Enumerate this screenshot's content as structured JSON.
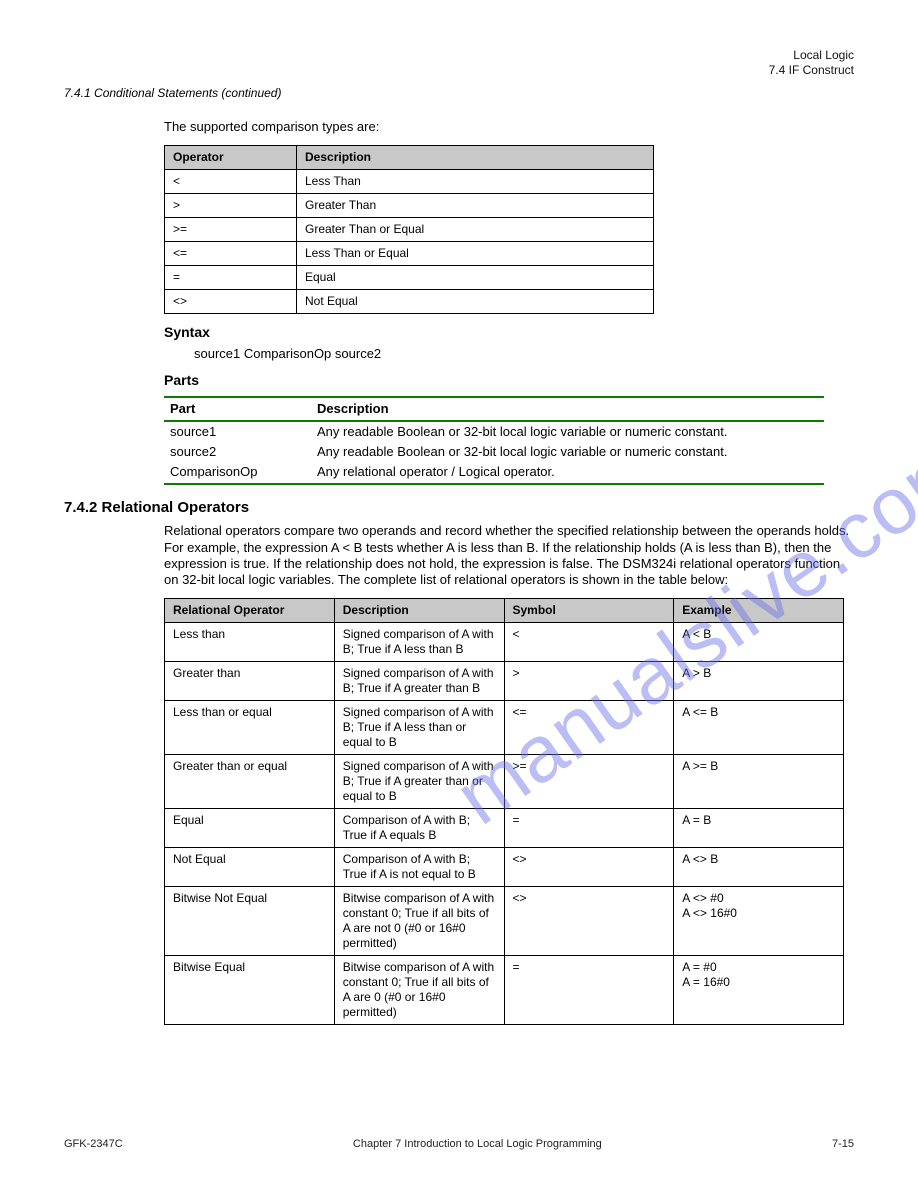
{
  "header": {
    "right_line1": "Local Logic",
    "right_line2": "7.4 IF Construct",
    "left": "7.4.1 Conditional Statements (continued)"
  },
  "comparison_section": {
    "intro": "The supported comparison types are:",
    "headers": [
      "Operator",
      "Description"
    ],
    "rows": [
      [
        "<",
        "Less Than"
      ],
      [
        ">",
        "Greater Than"
      ],
      [
        ">=",
        "Greater Than or Equal"
      ],
      [
        "<=",
        "Less Than or Equal"
      ],
      [
        "=",
        "Equal"
      ],
      [
        "<>",
        "Not Equal"
      ]
    ]
  },
  "syntax_section": {
    "title": "Syntax",
    "line": "source1 ComparisonOp source2"
  },
  "parts_section": {
    "title": "Parts",
    "headers": [
      "Part",
      "Description"
    ],
    "rows": [
      [
        "source1",
        "Any readable Boolean or 32-bit local logic variable or numeric constant."
      ],
      [
        "source2",
        "Any readable Boolean or 32-bit local logic variable or numeric constant."
      ],
      [
        "ComparisonOp",
        "Any relational operator / Logical operator."
      ]
    ]
  },
  "relational_section": {
    "title": "7.4.2 Relational Operators",
    "intro": "Relational operators compare two operands and record whether the specified relationship between the operands holds. For example, the expression A < B tests whether A is less than B. If the relationship holds (A is less than B), then the expression is true. If the relationship does not hold, the expression is false. The DSM324i relational operators function on 32-bit local logic variables. The complete list of relational operators is shown in the table below:",
    "headers": [
      "Relational Operator",
      "Description",
      "Symbol",
      "Example"
    ],
    "rows": [
      [
        "Less than",
        "Signed comparison of A with B; True if A less than B",
        "<",
        "A < B"
      ],
      [
        "Greater than",
        "Signed comparison of A with B; True if A greater than B",
        ">",
        "A > B"
      ],
      [
        "Less than or equal",
        "Signed comparison of A with B; True if A less than or equal to B",
        "<=",
        "A <= B"
      ],
      [
        "Greater than or equal",
        "Signed comparison of A with B; True if A greater than or equal to B",
        ">=",
        "A >= B"
      ],
      [
        "Equal",
        "Comparison of A with B; True if A equals B",
        "=",
        "A = B"
      ],
      [
        "Not Equal",
        "Comparison of A with B; True if A is not equal to B",
        "<>",
        "A <> B"
      ],
      [
        "Bitwise Not Equal",
        "Bitwise comparison of A with constant 0; True if all bits of A are not 0 (#0 or 16#0 permitted)",
        "<>",
        "A <> #0\nA <> 16#0"
      ],
      [
        "Bitwise Equal",
        "Bitwise comparison of A with constant 0; True if all bits of A are 0 (#0 or 16#0 permitted)",
        "=",
        "A = #0\nA = 16#0"
      ]
    ]
  },
  "footer": {
    "left": "GFK-2347C",
    "center": "Chapter 7 Introduction to Local Logic Programming",
    "right": "7-15"
  },
  "watermark": "manualslive.com"
}
